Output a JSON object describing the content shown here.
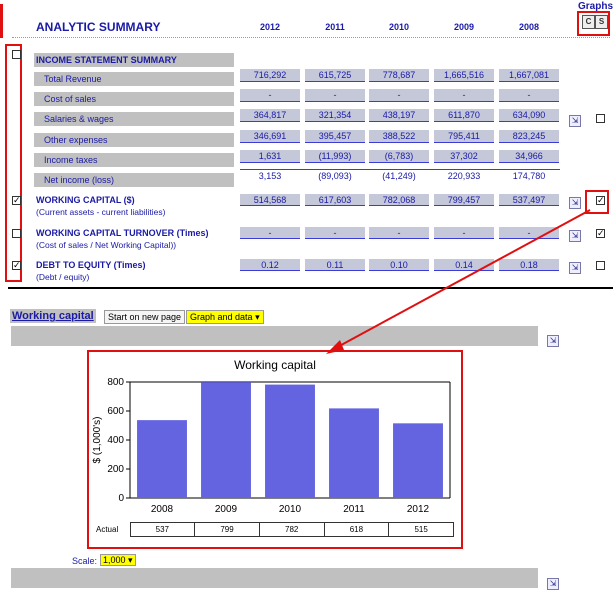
{
  "header": {
    "title": "ANALYTIC SUMMARY",
    "years": [
      "2012",
      "2011",
      "2010",
      "2009",
      "2008"
    ],
    "graphs_label": "Graphs",
    "graph_btn_c": "C",
    "graph_btn_s": "S"
  },
  "income_summary": {
    "heading": "INCOME STATEMENT SUMMARY",
    "rows": [
      {
        "label": "Total Revenue",
        "values": [
          "716,292",
          "615,725",
          "778,687",
          "1,665,516",
          "1,667,081"
        ]
      },
      {
        "label": "Cost of sales",
        "values": [
          "-",
          "-",
          "-",
          "-",
          "-"
        ]
      },
      {
        "label": "Salaries & wages",
        "values": [
          "364,817",
          "321,354",
          "438,197",
          "611,870",
          "634,090"
        ]
      },
      {
        "label": "Other expenses",
        "values": [
          "346,691",
          "395,457",
          "388,522",
          "795,411",
          "823,245"
        ]
      },
      {
        "label": "Income taxes",
        "values": [
          "1,631",
          "(11,993)",
          "(6,783)",
          "37,302",
          "34,966"
        ]
      },
      {
        "label": "Net income (loss)",
        "values": [
          "3,153",
          "(89,093)",
          "(41,249)",
          "220,933",
          "174,780"
        ]
      }
    ]
  },
  "ratios": [
    {
      "title": "WORKING CAPITAL ($)",
      "subtitle": "(Current assets - current liabilities)",
      "values": [
        "514,568",
        "617,603",
        "782,068",
        "799,457",
        "537,497"
      ],
      "left_checked": true,
      "right_checked": true
    },
    {
      "title": "WORKING CAPITAL TURNOVER (Times)",
      "subtitle": "(Cost of sales / Net Working Capital))",
      "values": [
        "-",
        "-",
        "-",
        "-",
        "-"
      ],
      "left_checked": false,
      "right_checked": true
    },
    {
      "title": "DEBT TO EQUITY (Times)",
      "subtitle": "(Debt / equity)",
      "values": [
        "0.12",
        "0.11",
        "0.10",
        "0.14",
        "0.18"
      ],
      "left_checked": true,
      "right_checked": false
    }
  ],
  "section": {
    "title": "Working capital",
    "start_new_page": "Start on new page",
    "graph_option": "Graph and data",
    "scale_label": "Scale:",
    "scale_value": "1,000"
  },
  "chart_data": {
    "type": "bar",
    "title": "Working capital",
    "ylabel": "$ (1,000's)",
    "categories": [
      "2008",
      "2009",
      "2010",
      "2011",
      "2012"
    ],
    "values": [
      537,
      799,
      782,
      618,
      515
    ],
    "ylim": [
      0,
      800
    ],
    "yticks": [
      "0",
      "200",
      "400",
      "600",
      "800"
    ],
    "row_label": "Actual",
    "bar_color": "#6464e0"
  },
  "colors": {
    "accent": "#1a1aa6",
    "highlight": "#e01010",
    "label_bg": "#c0c0c0",
    "value_bg": "#c4c8d8"
  }
}
